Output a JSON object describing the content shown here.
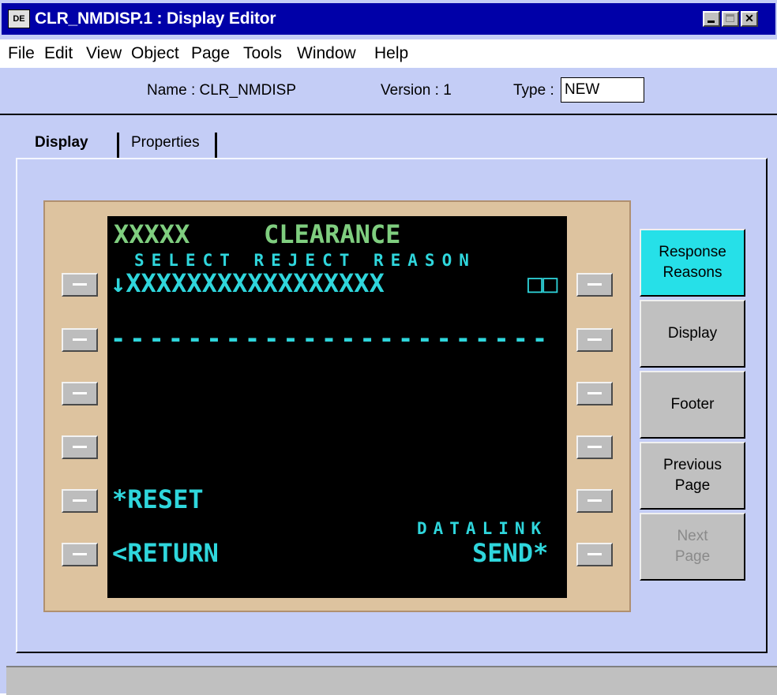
{
  "window": {
    "title": "CLR_NMDISP.1 : Display Editor",
    "icon_label": "DE"
  },
  "title_buttons": [
    "minimize",
    "maximize",
    "close"
  ],
  "menu": [
    "File",
    "Edit",
    "View",
    "Object",
    "Page",
    "Tools",
    "Window",
    "Help"
  ],
  "info": {
    "name_label": "Name : CLR_NMDISP",
    "version_label": "Version : 1",
    "type_label": "Type :",
    "type_value": "NEW"
  },
  "tabs": {
    "display": "Display",
    "properties": "Properties"
  },
  "cdu": {
    "title_left": "XXXXX",
    "title_main": "CLEARANCE",
    "subtitle": "SELECT REJECT REASON",
    "line1": "↓XXXXXXXXXXXXXXXXX",
    "line1_right": "□□",
    "dashes": "-----------------------",
    "reset": "*RESET",
    "return": "<RETURN",
    "datalink": "DATALINK",
    "send": "SEND*"
  },
  "side_buttons": {
    "response_reasons": "Response\nReasons",
    "display": "Display",
    "footer": "Footer",
    "previous_page": "Previous\nPage",
    "next_page": "Next\nPage"
  },
  "colors": {
    "accent_cyan": "#26e0e8",
    "cdu_green": "#7fce7f",
    "cdu_cyan": "#2fd6dc",
    "titlebar": "#0000a8"
  },
  "icons": {
    "app_icon": "display-editor-icon",
    "minimize": "minimize-icon",
    "maximize": "maximize-icon",
    "close": "close-icon",
    "line_select_key": "line-select-key-icon"
  }
}
